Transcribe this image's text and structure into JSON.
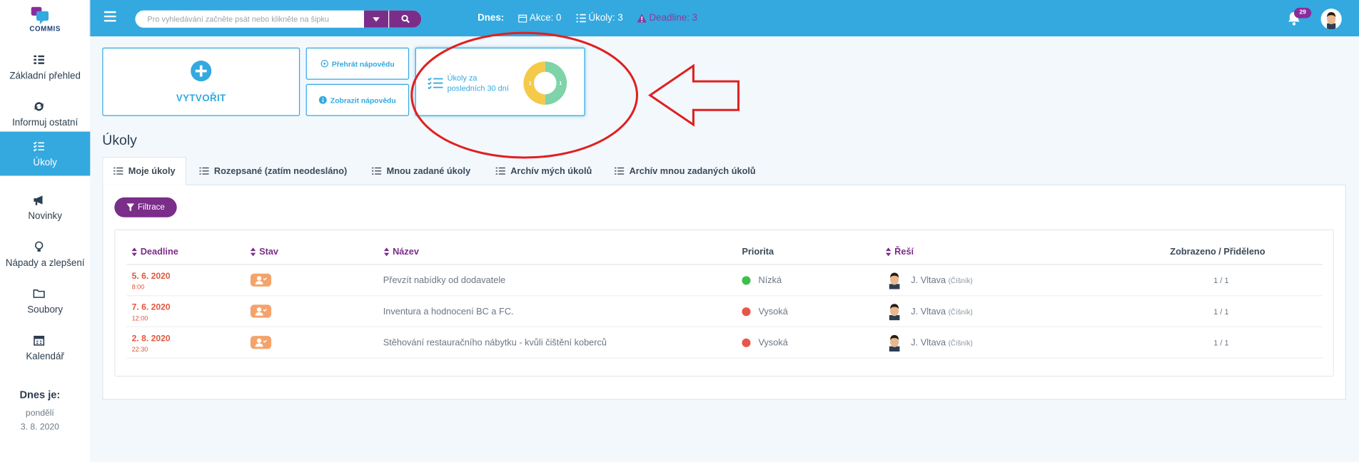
{
  "app": {
    "logo_text": "COMMIS"
  },
  "topbar": {
    "search_placeholder": "Pro vyhledávání začněte psát nebo klikněte na šipku",
    "today_label": "Dnes:",
    "akce": "Akce: 0",
    "ukoly": "Úkoly: 3",
    "deadline": "Deadline: 3",
    "notification_count": "29"
  },
  "sidebar": {
    "items": [
      {
        "label": "Základní přehled",
        "icon": "list-icon"
      },
      {
        "label": "Informuj ostatní",
        "icon": "sync-icon"
      },
      {
        "label": "Úkoly",
        "icon": "tasks-icon"
      },
      {
        "label": "Novinky",
        "icon": "megaphone-icon"
      },
      {
        "label": "Nápady a zlepšení",
        "icon": "lightbulb-icon"
      },
      {
        "label": "Soubory",
        "icon": "folder-icon"
      },
      {
        "label": "Kalendář",
        "icon": "calendar-icon"
      }
    ],
    "active_index": 2,
    "today_title": "Dnes je:",
    "today_day": "pondělí",
    "today_date": "3. 8. 2020"
  },
  "widgets": {
    "create_label": "VYTVOŘIT",
    "help_play": "Přehrát nápovědu",
    "help_show": "Zobrazit nápovědu",
    "stats_label": "Úkoly za posledních 30 dní",
    "donut": {
      "left_value": "1",
      "right_value": "1",
      "left_color": "#f5c94a",
      "right_color": "#7ed3a8"
    }
  },
  "page": {
    "title": "Úkoly",
    "tabs": [
      "Moje úkoly",
      "Rozepsané (zatím neodesláno)",
      "Mnou zadané úkoly",
      "Archív mých úkolů",
      "Archív mnou zadaných úkolů"
    ],
    "filter_label": "Filtrace"
  },
  "table": {
    "headers": {
      "deadline": "Deadline",
      "stav": "Stav",
      "nazev": "Název",
      "priorita": "Priorita",
      "resi": "Řeší",
      "zobrazeno": "Zobrazeno / Přiděleno"
    },
    "rows": [
      {
        "date": "5. 6. 2020",
        "time": "8:00",
        "name": "Převzít nabídky od dodavatele",
        "priority": "Nízká",
        "priority_color": "#3cc04a",
        "person": "J. Vltava",
        "role": "(Číšník)",
        "count": "1 / 1"
      },
      {
        "date": "7. 6. 2020",
        "time": "12:00",
        "name": "Inventura a hodnocení BC a FC.",
        "priority": "Vysoká",
        "priority_color": "#e8564a",
        "person": "J. Vltava",
        "role": "(Číšník)",
        "count": "1 / 1"
      },
      {
        "date": "2. 8. 2020",
        "time": "22:30",
        "name": "Stěhování restauračního nábytku - kvůli čištění koberců",
        "priority": "Vysoká",
        "priority_color": "#e8564a",
        "person": "J. Vltava",
        "role": "(Číšník)",
        "count": "1 / 1"
      }
    ]
  },
  "colors": {
    "accent": "#33a9e0",
    "brand": "#7b2d8a",
    "annotation": "#e02020"
  }
}
